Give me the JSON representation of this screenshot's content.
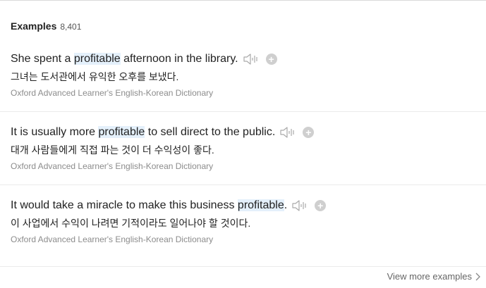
{
  "header": {
    "title": "Examples",
    "count": "8,401"
  },
  "examples": [
    {
      "before": "She spent a ",
      "highlight": "profitable",
      "after": " afternoon in the library.",
      "translation": "그녀는 도서관에서 유익한 오후를 보냈다.",
      "source": "Oxford Advanced Learner's English-Korean Dictionary"
    },
    {
      "before": "It is usually more ",
      "highlight": "profitable",
      "after": " to sell direct to the public.",
      "translation": "대개 사람들에게 직접 파는 것이 더 수익성이 좋다.",
      "source": "Oxford Advanced Learner's English-Korean Dictionary"
    },
    {
      "before": "It would take a miracle to make this business ",
      "highlight": "profitable",
      "after": ".",
      "translation": "이 사업에서 수익이 나려면 기적이라도 일어나야 할 것이다.",
      "source": "Oxford Advanced Learner's English-Korean Dictionary"
    }
  ],
  "footer": {
    "view_more_label": "View more examples"
  },
  "icons": {
    "speaker": "speaker-icon",
    "add": "plus-icon",
    "chevron": "chevron-right-icon"
  },
  "colors": {
    "highlight": "#e4f0fb",
    "icon_gray": "#cfcfcf"
  }
}
